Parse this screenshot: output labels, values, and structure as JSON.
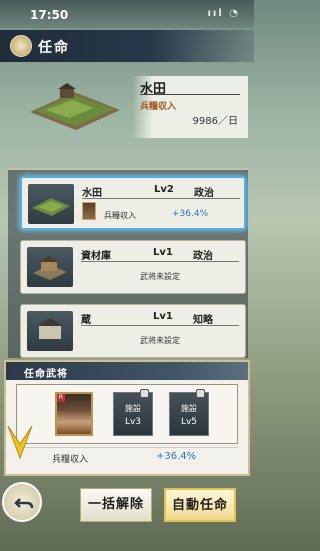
{
  "status": {
    "time": "17:50",
    "icons": "ııl ◔"
  },
  "title": "任命",
  "preview": {
    "name": "水田",
    "stat_label": "兵糧収入",
    "stat_value": "9986／日"
  },
  "cards": [
    {
      "name": "水田",
      "level": "Lv2",
      "attr": "政治",
      "stat_label": "兵糧収入",
      "stat_value": "+36.4%",
      "selected": true
    },
    {
      "name": "資材庫",
      "level": "Lv1",
      "attr": "政治",
      "status": "武将未設定",
      "selected": false
    },
    {
      "name": "蔵",
      "level": "Lv1",
      "attr": "知略",
      "status": "武将未設定",
      "selected": false
    }
  ],
  "assign": {
    "title": "任命武将",
    "slots": [
      {
        "label": "施設",
        "level": "Lv3"
      },
      {
        "label": "施設",
        "level": "Lv5"
      }
    ],
    "stat_label": "兵糧収入",
    "stat_value": "+36.4%"
  },
  "buttons": {
    "bulk_release": "一括解除",
    "auto_assign": "自動任命"
  },
  "colors": {
    "accent_blue": "#52aee8",
    "gold": "#e4c24f",
    "header_dark": "#1f2c3a"
  }
}
